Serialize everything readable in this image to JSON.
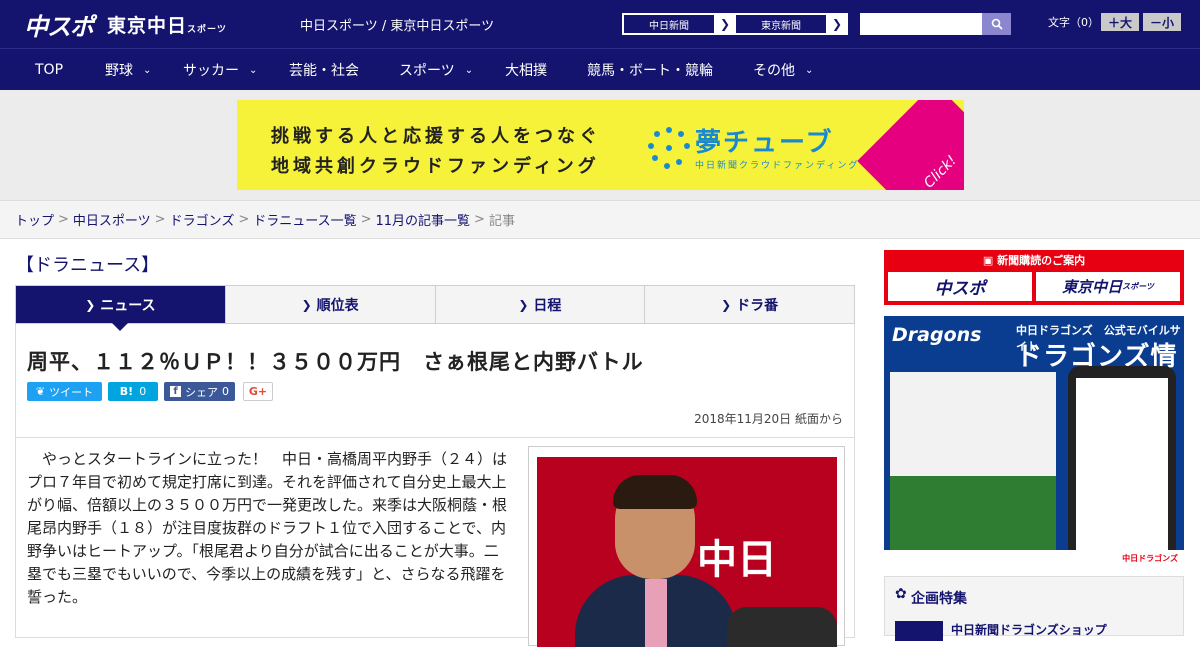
{
  "header": {
    "logo_main": "中スポ",
    "logo_sub": "東京中日",
    "logo_sub_small": "スポーツ",
    "site_title": "中日スポーツ / 東京中日スポーツ",
    "paper_buttons": [
      "中日新聞",
      "東京新聞"
    ],
    "search_placeholder": "",
    "font_label": "文字（0）",
    "font_bigger": "＋大",
    "font_smaller": "－小"
  },
  "nav": {
    "items": [
      {
        "label": "TOP",
        "dropdown": false
      },
      {
        "label": "野球",
        "dropdown": true
      },
      {
        "label": "サッカー",
        "dropdown": true
      },
      {
        "label": "芸能・社会",
        "dropdown": false
      },
      {
        "label": "スポーツ",
        "dropdown": true
      },
      {
        "label": "大相撲",
        "dropdown": false
      },
      {
        "label": "競馬・ボート・競輪",
        "dropdown": false
      },
      {
        "label": "その他",
        "dropdown": true
      }
    ]
  },
  "ad": {
    "line1": "挑戦する人と応援する人をつなぐ",
    "line2": "地域共創クラウドファンディング",
    "brand": "夢チューブ",
    "brand_sub": "中日新聞クラウドファンディング",
    "click": "Click!",
    "accent": "#f6f23a"
  },
  "breadcrumb": {
    "items": [
      "トップ",
      "中日スポーツ",
      "ドラゴンズ",
      "ドラニュース一覧",
      "11月の記事一覧"
    ],
    "current": "記事"
  },
  "section_title": "【ドラニュース】",
  "tabs": [
    {
      "label": "ニュース",
      "active": true
    },
    {
      "label": "順位表",
      "active": false
    },
    {
      "label": "日程",
      "active": false
    },
    {
      "label": "ドラ番",
      "active": false
    }
  ],
  "article": {
    "headline": "周平、１１２％ＵＰ！！３５００万円　さぁ根尾と内野バトル",
    "share": {
      "tweet": "ツイート",
      "hatena": "B!",
      "hatena_count": "0",
      "fb": "シェア",
      "fb_count": "0",
      "gplus": "G+"
    },
    "dateline": "2018年11月20日 紙面から",
    "body": "やっとスタートラインに立った！　中日・高橋周平内野手（２４）はプロ７年目で初めて規定打席に到達。それを評価されて自分史上最大上がり幅、倍額以上の３５００万円で一発更改した。来季は大阪桐蔭・根尾昂内野手（１８）が注目度抜群のドラフト１位で入団することで、内野争いはヒートアップ。「根尾君より自分が試合に出ることが大事。二塁でも三塁でもいいので、今季以上の成績を残す」と、さらなる飛躍を誓った。",
    "photo_banner": "中日"
  },
  "sidebar": {
    "subscribe_header": "新聞購読のご案内",
    "subscribe_b1": "中スポ",
    "subscribe_b2": "東京中日",
    "subscribe_b2_small": "スポーツ",
    "mobile_logo": "Dragons",
    "mobile_sub": "中日ドラゴンズ　公式モバイルサイト",
    "mobile_title": "ドラゴンズ情報",
    "mobile_footer": "中日ドラゴンズ",
    "feature_title": "企画特集",
    "feature_item": "中日新聞ドラゴンズショップ"
  },
  "colors": {
    "primary": "#14146e",
    "twitter": "#1da1f2",
    "hatena": "#00a4de",
    "facebook": "#3b5998",
    "red": "#e60012"
  }
}
